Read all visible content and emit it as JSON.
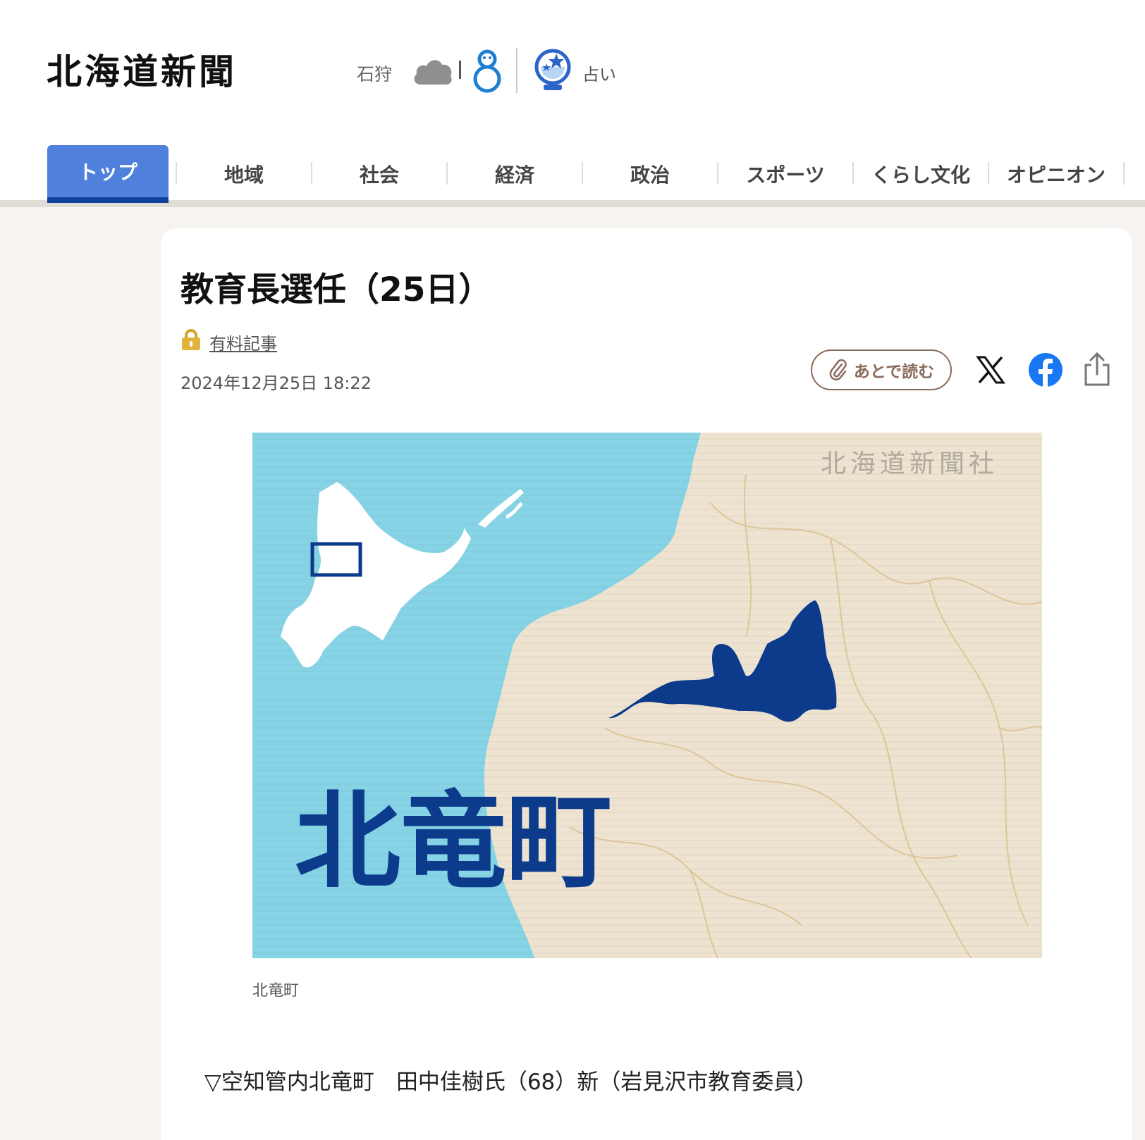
{
  "header": {
    "logo": "北海道新聞",
    "weather": {
      "city": "石狩",
      "condition_icon": "cloud-icon",
      "temperature": "8"
    },
    "fortune_label": "占い"
  },
  "nav": {
    "items": [
      {
        "label": "トップ",
        "active": true
      },
      {
        "label": "地域"
      },
      {
        "label": "社会"
      },
      {
        "label": "経済"
      },
      {
        "label": "政治"
      },
      {
        "label": "スポーツ"
      },
      {
        "label": "くらし文化"
      },
      {
        "label": "オピニオン"
      }
    ]
  },
  "article": {
    "title": "教育長選任（25日）",
    "paid_label": "有料記事",
    "date": "2024年12月25日 18:22",
    "read_later_label": "あとで読む",
    "image": {
      "watermark": "北海道新聞社",
      "place_label": "北竜町",
      "caption": "北竜町"
    },
    "body": "▽空知管内北竜町　田中佳樹氏（68）新（岩見沢市教育委員）"
  },
  "colors": {
    "nav_active": "#4f80dc",
    "nav_active_border": "#11429a",
    "map_sea": "#86d3e6",
    "map_land": "#ede3d0",
    "map_highlight": "#0c3b8c",
    "read_later": "#8a6a5a",
    "facebook": "#1877f2"
  }
}
